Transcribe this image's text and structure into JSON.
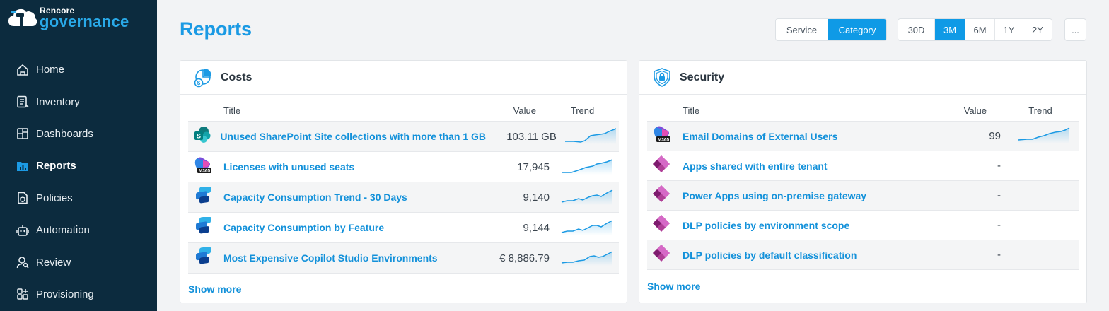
{
  "brand": {
    "top": "Rencore",
    "bottom": "governance",
    "accent": "#29a9e8",
    "sidebar_bg": "#0c2b3e"
  },
  "nav": [
    {
      "label": "Home",
      "icon": "home-icon",
      "active": false
    },
    {
      "label": "Inventory",
      "icon": "inventory-icon",
      "active": false
    },
    {
      "label": "Dashboards",
      "icon": "dashboards-icon",
      "active": false
    },
    {
      "label": "Reports",
      "icon": "reports-icon",
      "active": true
    },
    {
      "label": "Policies",
      "icon": "policies-icon",
      "active": false
    },
    {
      "label": "Automation",
      "icon": "automation-icon",
      "active": false
    },
    {
      "label": "Review",
      "icon": "review-icon",
      "active": false
    },
    {
      "label": "Provisioning",
      "icon": "provisioning-icon",
      "active": false
    }
  ],
  "header": {
    "title": "Reports",
    "view_toggle": [
      {
        "label": "Service",
        "selected": false
      },
      {
        "label": "Category",
        "selected": true
      }
    ],
    "range_toggle": [
      {
        "label": "30D",
        "selected": false
      },
      {
        "label": "3M",
        "selected": true
      },
      {
        "label": "6M",
        "selected": false
      },
      {
        "label": "1Y",
        "selected": false
      },
      {
        "label": "2Y",
        "selected": false
      }
    ],
    "more_label": "..."
  },
  "costs": {
    "title": "Costs",
    "icon": "costs-icon",
    "columns": {
      "title": "Title",
      "value": "Value",
      "trend": "Trend"
    },
    "rows": [
      {
        "icon": "sharepoint-icon",
        "title": "Unused SharePoint Site collections with more than 1 GB",
        "value": "103.11 GB",
        "trend": "trend-sparkline"
      },
      {
        "icon": "m365-icon",
        "title": "Licenses with unused seats",
        "value": "17,945",
        "trend": "trend-sparkline"
      },
      {
        "icon": "copilot-studio-icon",
        "title": "Capacity Consumption Trend - 30 Days",
        "value": "9,140",
        "trend": "trend-sparkline"
      },
      {
        "icon": "copilot-studio-icon",
        "title": "Capacity Consumption by Feature",
        "value": "9,144",
        "trend": "trend-sparkline"
      },
      {
        "icon": "copilot-studio-icon",
        "title": "Most Expensive Copilot Studio Environments",
        "value": "€ 8,886.79",
        "trend": "trend-sparkline"
      }
    ],
    "show_more": "Show more"
  },
  "security": {
    "title": "Security",
    "icon": "security-shield-icon",
    "columns": {
      "title": "Title",
      "value": "Value",
      "trend": "Trend"
    },
    "rows": [
      {
        "icon": "m365-icon",
        "title": "Email Domains of External Users",
        "value": "99",
        "trend": "trend-sparkline"
      },
      {
        "icon": "power-apps-icon",
        "title": "Apps shared with entire tenant",
        "value": "-",
        "trend": ""
      },
      {
        "icon": "power-apps-icon",
        "title": "Power Apps using on-premise gateway",
        "value": "-",
        "trend": ""
      },
      {
        "icon": "power-apps-icon",
        "title": "DLP policies by environment scope",
        "value": "-",
        "trend": ""
      },
      {
        "icon": "power-apps-icon",
        "title": "DLP policies by default classification",
        "value": "-",
        "trend": ""
      }
    ],
    "show_more": "Show more"
  },
  "colors": {
    "accent": "#0f9ae6",
    "link": "#1391da",
    "title": "#1b9ae4"
  }
}
